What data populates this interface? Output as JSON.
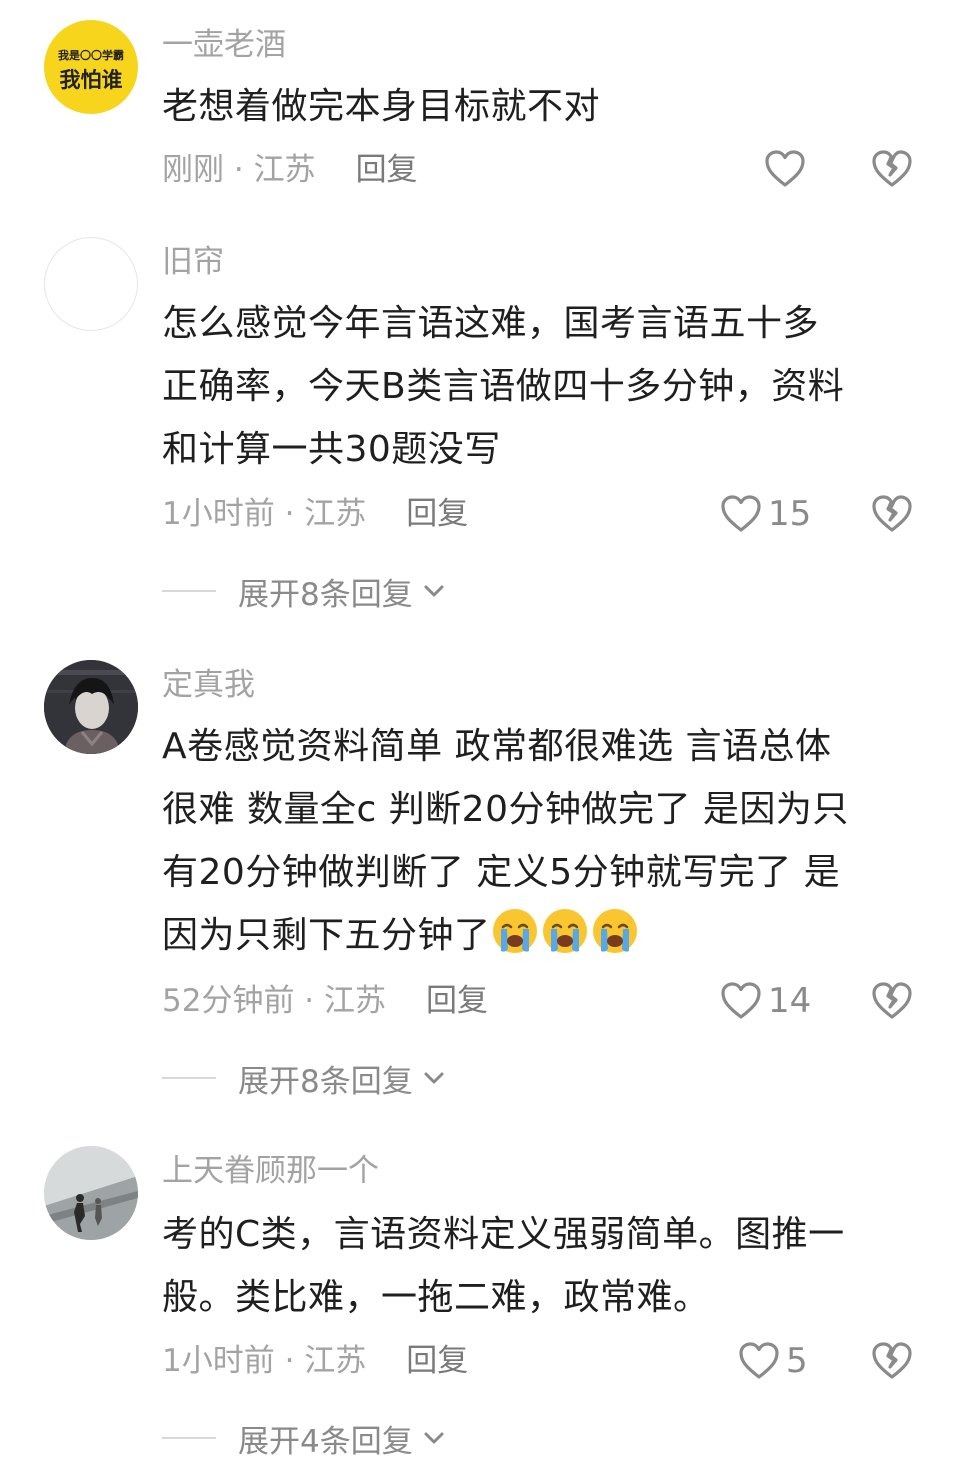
{
  "comments": [
    {
      "username": "一壶老酒",
      "avatar": {
        "style": "yellow-text",
        "line1": "我是〇〇学霸",
        "line2": "我怕谁"
      },
      "text_lines": [
        "老想着做完本身目标就不对"
      ],
      "time": "刚刚",
      "location": "江苏",
      "reply_label": "回复",
      "likes": ""
    },
    {
      "username": "旧帘",
      "avatar": {
        "style": "blank"
      },
      "text_lines": [
        "怎么感觉今年言语这难，国考言语五十多",
        "正确率，今天B类言语做四十多分钟，资料",
        "和计算一共30题没写"
      ],
      "time": "1小时前",
      "location": "江苏",
      "reply_label": "回复",
      "likes": "15",
      "expand_label": "展开8条回复"
    },
    {
      "username": "定真我",
      "avatar": {
        "style": "anime-dark"
      },
      "text_lines": [
        "A卷感觉资料简单 政常都很难选 言语总体",
        "很难 数量全c 判断20分钟做完了 是因为只",
        "有20分钟做判断了 定义5分钟就写完了 是",
        "因为只剩下五分钟了"
      ],
      "emojis": [
        "crying-face-emoji",
        "crying-face-emoji",
        "crying-face-emoji"
      ],
      "time": "52分钟前",
      "location": "江苏",
      "reply_label": "回复",
      "likes": "14",
      "expand_label": "展开8条回复"
    },
    {
      "username": "上天眷顾那一个",
      "avatar": {
        "style": "grey-photo"
      },
      "text_lines": [
        "考的C类，言语资料定义强弱简单。图推一",
        "般。类比难，一拖二难，政常难。"
      ],
      "time": "1小时前",
      "location": "江苏",
      "reply_label": "回复",
      "likes": "5",
      "expand_label": "展开4条回复"
    }
  ],
  "separator": " · ",
  "icons": {
    "like": "heart-outline-icon",
    "dislike": "broken-heart-icon",
    "expand": "chevron-down-icon"
  },
  "colors": {
    "meta": "#a3a3a3",
    "text": "#1f1f1f",
    "icon": "#8a8a8a",
    "avatar_yellow": "#f7d51d"
  }
}
